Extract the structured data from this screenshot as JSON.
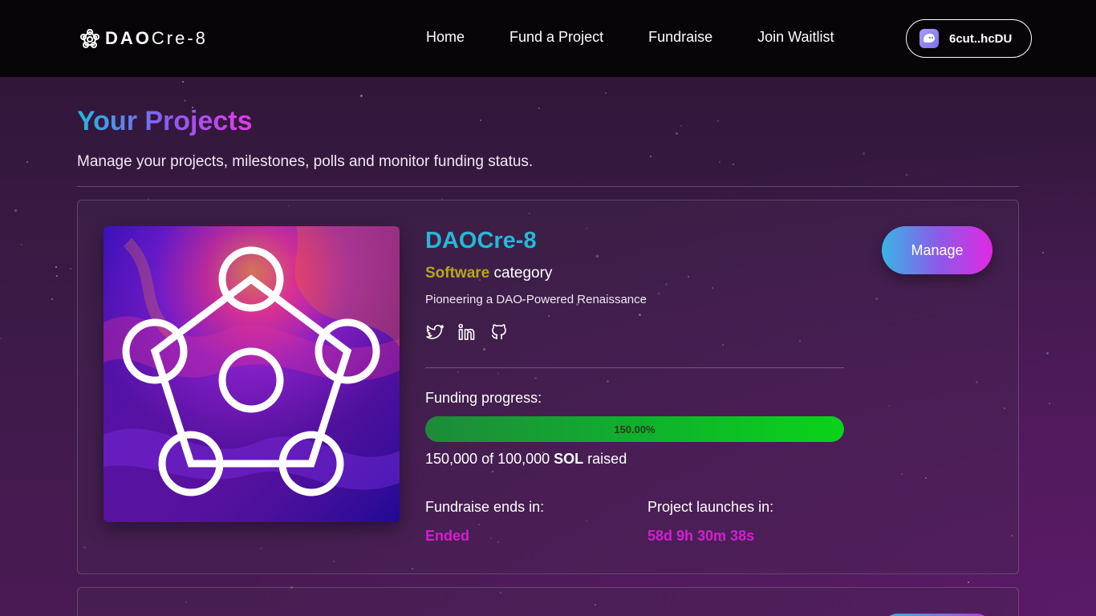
{
  "brand": {
    "name_bold": "DAO",
    "name_rest": "Cre-8"
  },
  "nav": {
    "items": [
      {
        "label": "Home"
      },
      {
        "label": "Fund a Project"
      },
      {
        "label": "Fundraise"
      },
      {
        "label": "Join Waitlist"
      }
    ],
    "wallet_label": "6cut..hcDU"
  },
  "page": {
    "title": "Your Projects",
    "subtitle": "Manage your projects, milestones, polls and monitor funding status."
  },
  "project": {
    "name": "DAOCre-8",
    "category_value": "Software",
    "category_suffix": " category",
    "tagline": "Pioneering a DAO-Powered Renaissance",
    "socials": [
      "twitter-icon",
      "linkedin-icon",
      "github-icon"
    ],
    "funding_label": "Funding progress:",
    "progress_text": "150.00%",
    "progress_fraction": 1.0,
    "raised_amount": "150,000 of 100,000 ",
    "raised_currency": "SOL",
    "raised_suffix": " raised",
    "ends_label": "Fundraise ends in:",
    "ends_value": "Ended",
    "launch_label": "Project launches in:",
    "launch_value": "58d 9h 30m 38s",
    "manage_label": "Manage"
  },
  "colors": {
    "accent_teal": "#25b8d8",
    "category_gold": "#b8a81c",
    "countdown_magenta": "#d21fd0",
    "progress_green": "#0ad31a"
  }
}
